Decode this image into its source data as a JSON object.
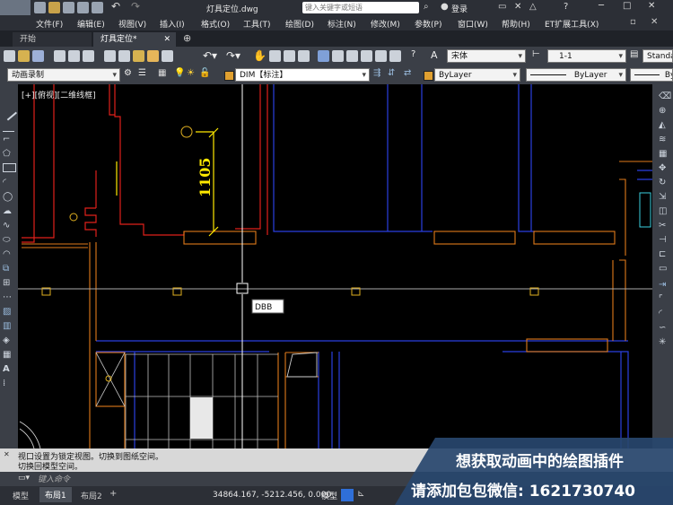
{
  "window": {
    "title": "灯具定位.dwg",
    "search_placeholder": "键入关键字或短语",
    "login_label": "登录"
  },
  "menus": [
    "文件(F)",
    "编辑(E)",
    "视图(V)",
    "插入(I)",
    "格式(O)",
    "工具(T)",
    "绘图(D)",
    "标注(N)",
    "修改(M)",
    "参数(P)",
    "窗口(W)",
    "帮助(H)",
    "ET扩展工具(X)"
  ],
  "tabs": [
    {
      "label": "开始",
      "active": false
    },
    {
      "label": "灯具定位*",
      "active": true
    }
  ],
  "toolbar1": {
    "font_dropdown": "宋体",
    "scale_dropdown": "1-1",
    "style_dropdown": "Standa"
  },
  "toolbar2": {
    "workspace_dropdown": "动画录制",
    "layer_dropdown": "DIM【标注】",
    "color_dropdown": "ByLayer",
    "linetype_dropdown": "ByLayer",
    "lineweight_dropdown": "By"
  },
  "viewport_label": "[+][俯视][二维线框]",
  "drawing": {
    "dimension_text": "1105",
    "dynamic_input": "DBB"
  },
  "command": {
    "history": [
      "视口设置为锁定视图。切换到图纸空间。",
      "切换回模型空间。"
    ],
    "prompt_placeholder": "键入命令"
  },
  "status": {
    "layout_tabs": [
      "模型",
      "布局1",
      "布局2"
    ],
    "active_layout": "布局1",
    "coordinates": "34864.167, -5212.456, 0.000",
    "space_button": "模型"
  },
  "banner": {
    "line1": "想获取动画中的绘图插件",
    "line2": "请添加包包微信: 1621730740"
  },
  "colors": {
    "accent_blue": "#2f6fd8",
    "wall_orange": "#e07a1a",
    "wall_red": "#e0201a",
    "wall_blue": "#2a3fe0",
    "crosshair": "#ffffff",
    "dimension_yellow": "#ffea00"
  }
}
